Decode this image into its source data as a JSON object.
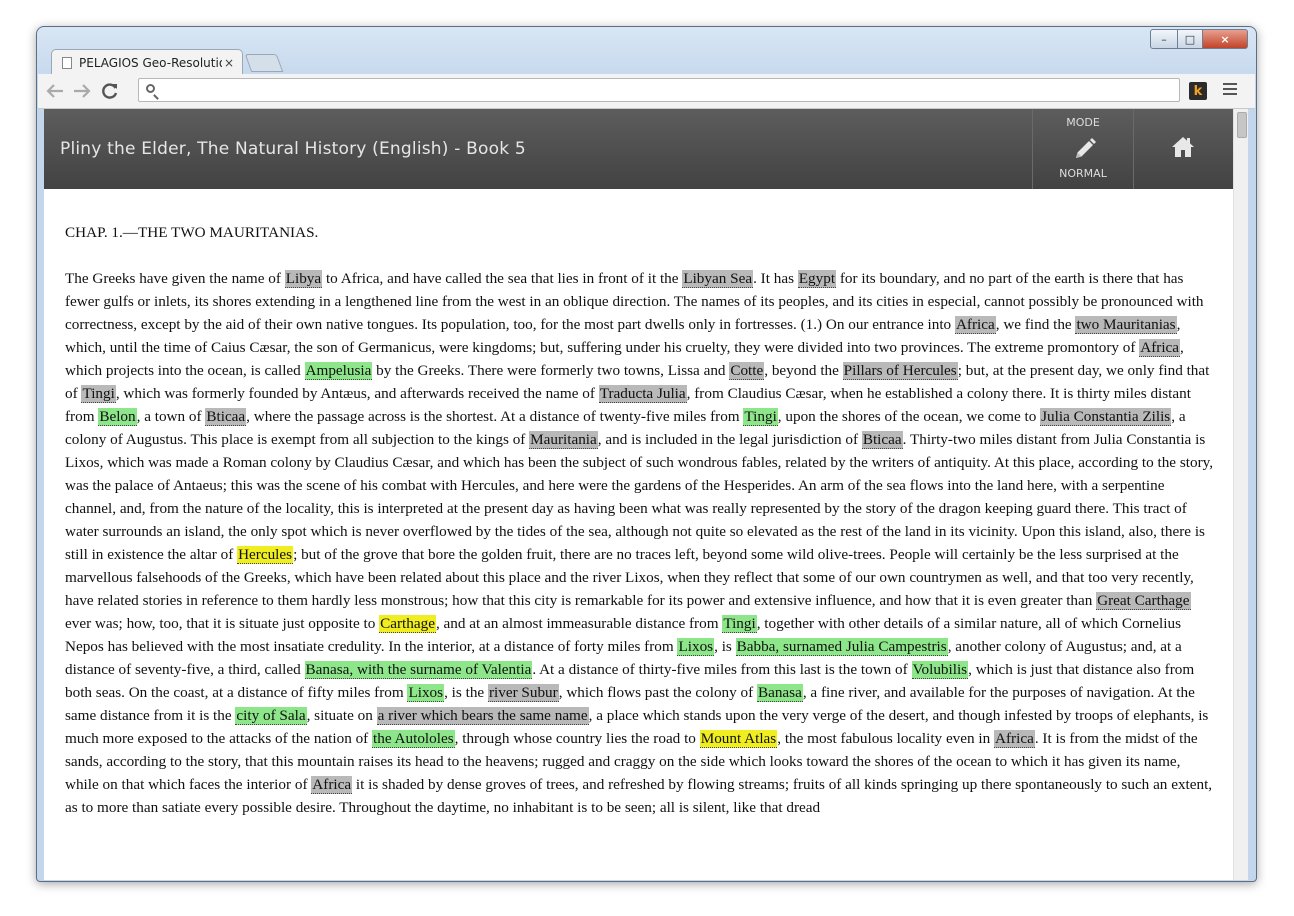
{
  "browser": {
    "tab_title": "PELAGIOS Geo-Resolution",
    "tab_close": "×",
    "url": "",
    "ext_label": "k",
    "win_min": "–",
    "win_max": "□",
    "win_close": "×"
  },
  "app": {
    "title": "Pliny the Elder, The Natural History (English) - Book 5",
    "mode_label": "MODE",
    "mode_value": "NORMAL"
  },
  "colors": {
    "grey_tag": "#b9b9b9",
    "green_tag": "#8ee68a",
    "yellow_tag": "#f0ee21",
    "header_bg": "#4f4f4f"
  },
  "chapter_heading": "CHAP. 1.—THE TWO MAURITANIAS.",
  "text_segments": [
    {
      "t": "The Greeks have given the name of "
    },
    {
      "t": "Libya",
      "h": "grey"
    },
    {
      "t": " to Africa, and have called the sea that lies in front of it the "
    },
    {
      "t": "Libyan Sea",
      "h": "grey"
    },
    {
      "t": ". It has "
    },
    {
      "t": "Egypt",
      "h": "grey"
    },
    {
      "t": " for its boundary, and no part of the earth is there that has fewer gulfs or inlets, its shores extending in a lengthened line from the west in an oblique direction. The names of its peoples, and its cities in especial, cannot possibly be pronounced with correctness, except by the aid of their own native tongues. Its population, too, for the most part dwells only in fortresses. (1.) On our entrance into "
    },
    {
      "t": "Africa",
      "h": "grey"
    },
    {
      "t": ", we find the "
    },
    {
      "t": "two Mauritanias",
      "h": "grey"
    },
    {
      "t": ", which, until the time of Caius Cæsar, the son of Germanicus, were kingdoms; but, suffering under his cruelty, they were divided into two provinces. The extreme promontory of "
    },
    {
      "t": "Africa",
      "h": "grey"
    },
    {
      "t": ", which projects into the ocean, is called "
    },
    {
      "t": "Ampelusia",
      "h": "green"
    },
    {
      "t": " by the Greeks. There were formerly two towns, Lissa and "
    },
    {
      "t": "Cotte",
      "h": "grey"
    },
    {
      "t": ", beyond the "
    },
    {
      "t": "Pillars of Hercules",
      "h": "grey"
    },
    {
      "t": "; but, at the present day, we only find that of "
    },
    {
      "t": "Tingi",
      "h": "grey"
    },
    {
      "t": ", which was formerly founded by Antæus, and afterwards received the name of "
    },
    {
      "t": "Traducta Julia",
      "h": "grey"
    },
    {
      "t": ", from Claudius Cæsar, when he established a colony there. It is thirty miles distant from "
    },
    {
      "t": "Belon",
      "h": "green"
    },
    {
      "t": ", a town of "
    },
    {
      "t": "Bticaa",
      "h": "grey"
    },
    {
      "t": ", where the passage across is the shortest. At a distance of twenty-five miles from "
    },
    {
      "t": "Tingi",
      "h": "green"
    },
    {
      "t": ", upon the shores of the ocean, we come to "
    },
    {
      "t": "Julia Constantia Zilis",
      "h": "grey"
    },
    {
      "t": ", a colony of Augustus. This place is exempt from all subjection to the kings of "
    },
    {
      "t": "Mauritania",
      "h": "grey"
    },
    {
      "t": ", and is included in the legal jurisdiction of "
    },
    {
      "t": "Bticaa",
      "h": "grey"
    },
    {
      "t": ". Thirty-two miles distant from Julia Constantia is Lixos, which was made a Roman colony by Claudius Cæsar, and which has been the subject of such wondrous fables, related by the writers of antiquity. At this place, according to the story, was the palace of Antaeus; this was the scene of his combat with Hercules, and here were the gardens of the Hesperides. An arm of the sea flows into the land here, with a serpentine channel, and, from the nature of the locality, this is interpreted at the present day as having been what was really represented by the story of the dragon keeping guard there. This tract of water surrounds an island, the only spot which is never overflowed by the tides of the sea, although not quite so elevated as the rest of the land in its vicinity. Upon this island, also, there is still in existence the altar of "
    },
    {
      "t": "Hercules",
      "h": "yellow"
    },
    {
      "t": "; but of the grove that bore the golden fruit, there are no traces left, beyond some wild olive-trees. People will certainly be the less surprised at the marvellous falsehoods of the Greeks, which have been related about this place and the river Lixos, when they reflect that some of our own countrymen as well, and that too very recently, have related stories in reference to them hardly less monstrous; how that this city is remarkable for its power and extensive influence, and how that it is even greater than "
    },
    {
      "t": "Great Carthage",
      "h": "grey"
    },
    {
      "t": " ever was; how, too, that it is situate just opposite to "
    },
    {
      "t": "Carthage",
      "h": "yellow"
    },
    {
      "t": ", and at an almost immeasurable distance from "
    },
    {
      "t": "Tingi",
      "h": "green"
    },
    {
      "t": ", together with other details of a similar nature, all of which Cornelius Nepos has believed with the most insatiate credulity. In the interior, at a distance of forty miles from "
    },
    {
      "t": "Lixos",
      "h": "green"
    },
    {
      "t": ", is "
    },
    {
      "t": "Babba, surnamed Julia Campestris",
      "h": "green"
    },
    {
      "t": ", another colony of Augustus; and, at a distance of seventy-five, a third, called "
    },
    {
      "t": "Banasa, with the surname of Valentia",
      "h": "green"
    },
    {
      "t": ". At a distance of thirty-five miles from this last is the town of "
    },
    {
      "t": "Volubilis",
      "h": "green"
    },
    {
      "t": ", which is just that distance also from both seas. On the coast, at a distance of fifty miles from "
    },
    {
      "t": "Lixos",
      "h": "green"
    },
    {
      "t": ", is the "
    },
    {
      "t": "river Subur",
      "h": "grey"
    },
    {
      "t": ", which flows past the colony of "
    },
    {
      "t": "Banasa",
      "h": "green"
    },
    {
      "t": ", a fine river, and available for the purposes of navigation. At the same distance from it is the "
    },
    {
      "t": "city of Sala",
      "h": "green"
    },
    {
      "t": ", situate on "
    },
    {
      "t": "a river which bears the same name",
      "h": "grey"
    },
    {
      "t": ", a place which stands upon the very verge of the desert, and though infested by troops of elephants, is much more exposed to the attacks of the nation of "
    },
    {
      "t": "the Autololes",
      "h": "green"
    },
    {
      "t": ", through whose country lies the road to "
    },
    {
      "t": "Mount Atlas",
      "h": "yellow"
    },
    {
      "t": ", the most fabulous locality even in "
    },
    {
      "t": "Africa",
      "h": "grey"
    },
    {
      "t": ". It is from the midst of the sands, according to the story, that this mountain raises its head to the heavens; rugged and craggy on the side which looks toward the shores of the ocean to which it has given its name, while on that which faces the interior of "
    },
    {
      "t": "Africa",
      "h": "grey"
    },
    {
      "t": " it is shaded by dense groves of trees, and refreshed by flowing streams; fruits of all kinds springing up there spontaneously to such an extent, as to more than satiate every possible desire. Throughout the daytime, no inhabitant is to be seen; all is silent, like that dread "
    }
  ]
}
